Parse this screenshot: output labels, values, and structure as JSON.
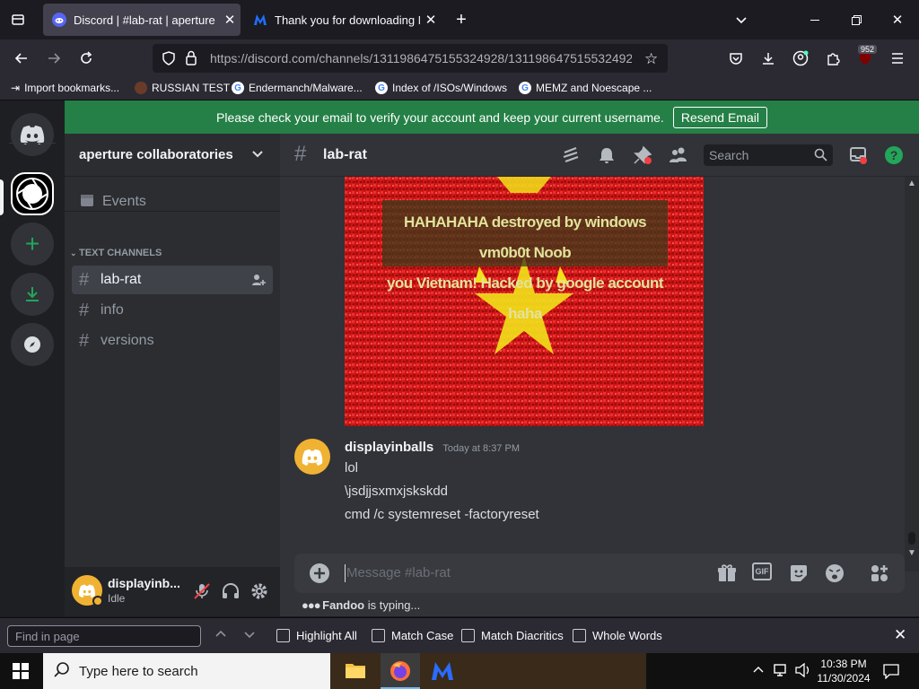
{
  "browser": {
    "tabs": [
      {
        "title": "Discord | #lab-rat | aperture coll",
        "active": true
      },
      {
        "title": "Thank you for downloading Ma",
        "active": false
      }
    ],
    "url": {
      "host": "https://discord.com",
      "path": "/channels/1311986475155324928/131198647515532492"
    },
    "bookmarks": [
      "Import bookmarks...",
      "RUSSIAN TEST",
      "Endermanch/Malware...",
      "Index of /ISOs/Windows",
      "MEMZ and Noescape ..."
    ],
    "badge_count": "952"
  },
  "discord": {
    "banner": {
      "text": "Please check your email to verify your account and keep your current username.",
      "button": "Resend Email"
    },
    "server_name": "aperture collaboratories",
    "events_label": "Events",
    "category": "TEXT CHANNELS",
    "channels": [
      "lab-rat",
      "info",
      "versions"
    ],
    "channel_title": "lab-rat",
    "search_placeholder": "Search",
    "image_caption": [
      "HAHAHAHA destroyed by windows vm0b0t Noob",
      "you Vietnam! Hacked by google account haha"
    ],
    "message": {
      "author": "displayinballs",
      "timestamp": "Today at 8:37 PM",
      "lines": [
        "lol",
        "\\jsdjjsxmxjskskdd",
        "cmd /c systemreset -factoryreset"
      ]
    },
    "composer_placeholder": "Message #lab-rat",
    "typing": {
      "user": "Fandoo",
      "suffix": "is typing..."
    },
    "user": {
      "name": "displayinb...",
      "status": "Idle"
    },
    "colors": {
      "accent": "#5865f2",
      "banner": "#248046",
      "avatar": "#f0b232",
      "green": "#23a55a"
    }
  },
  "findbar": {
    "placeholder": "Find in page",
    "options": [
      "Highlight All",
      "Match Case",
      "Match Diacritics",
      "Whole Words"
    ]
  },
  "taskbar": {
    "search_placeholder": "Type here to search",
    "time": "10:38 PM",
    "date": "11/30/2024"
  }
}
